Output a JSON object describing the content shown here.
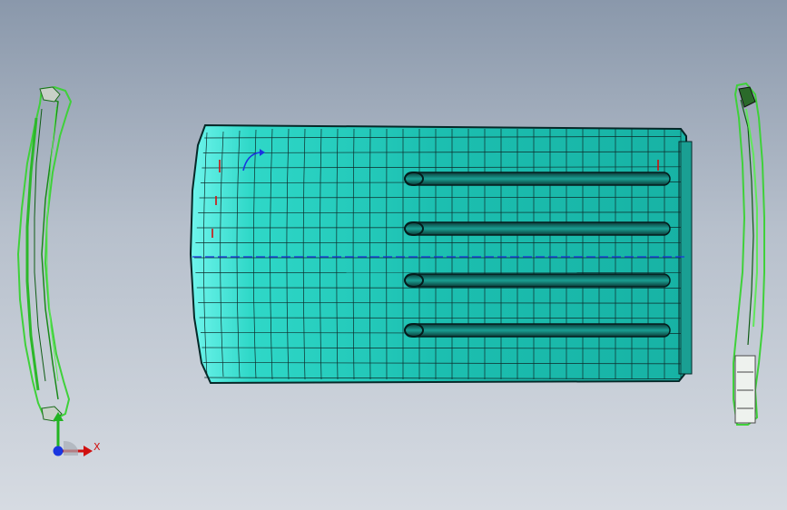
{
  "viewport": {
    "background_top": "#8a98ab",
    "background_bottom": "#d6dbe2"
  },
  "model": {
    "surface_color": "#1fc2b2",
    "surface_light": "#5ff0e6",
    "mesh_color": "#0d2a2a",
    "part_color": "#3fd13a",
    "slots": 4
  },
  "triad": {
    "x_label": "X",
    "x_color": "#d01010",
    "y_color": "#22b422",
    "origin_color": "#1a36e0"
  }
}
